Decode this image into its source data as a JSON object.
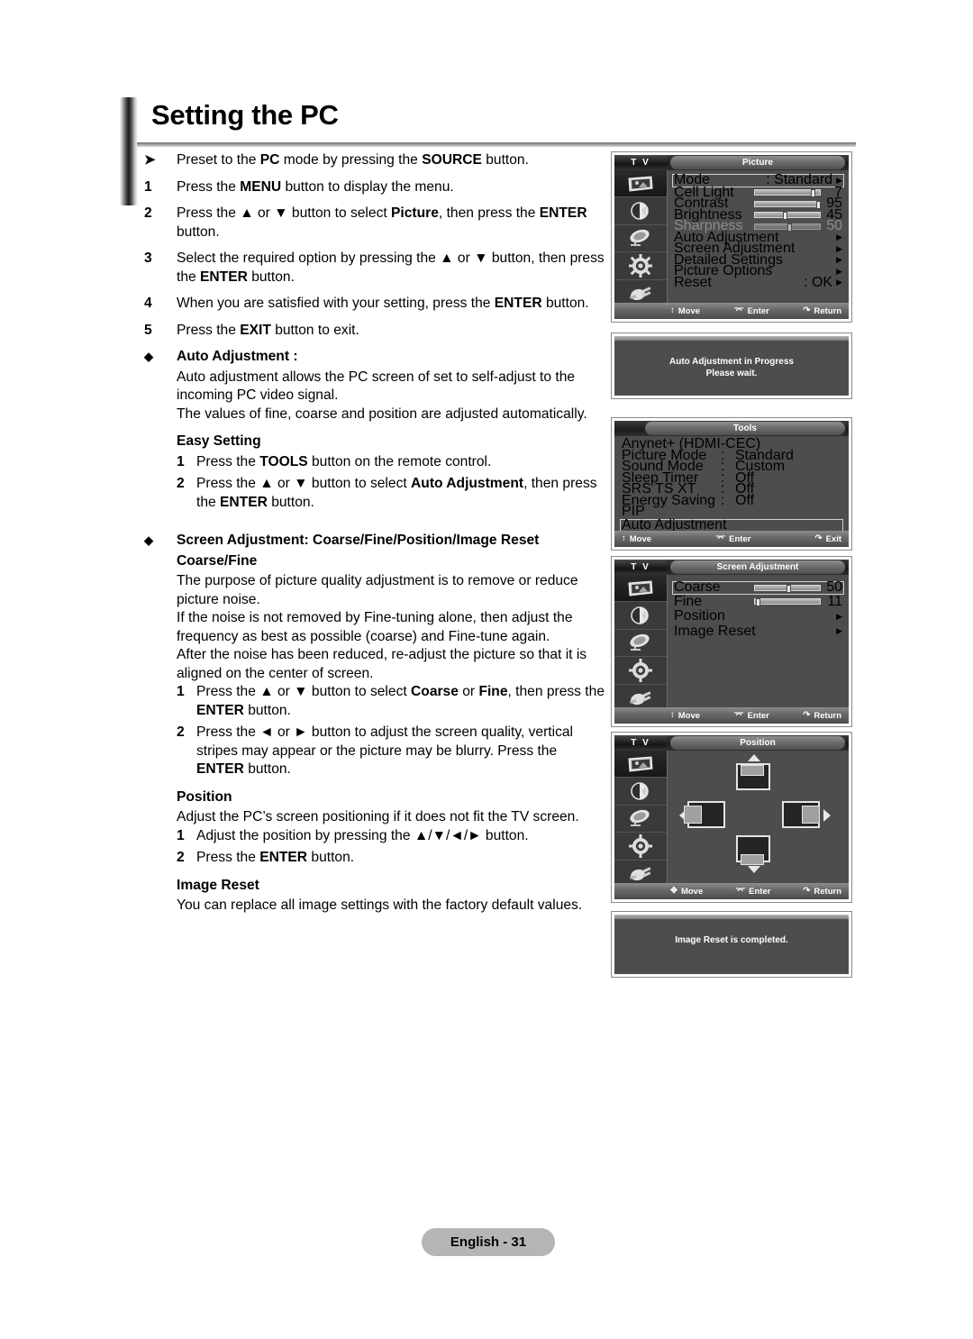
{
  "page": {
    "title": "Setting the PC",
    "footer_label": "English - 31"
  },
  "instructions": {
    "preset": {
      "marker": "➤",
      "text_1": "Preset to the ",
      "bold_1": "PC",
      "text_2": " mode by pressing the ",
      "bold_2": "SOURCE",
      "text_3": " button."
    },
    "steps": [
      {
        "num": "1",
        "html": "Press the <b>MENU</b> button to display the menu."
      },
      {
        "num": "2",
        "html": "Press the ▲ or ▼ button to select <b>Picture</b>, then press the <b>ENTER</b> button."
      },
      {
        "num": "3",
        "html": "Select the required option by pressing the ▲ or ▼ button, then press the <b>ENTER</b> button."
      },
      {
        "num": "4",
        "html": "When you are satisfied with your setting, press the <b>ENTER</b> button."
      },
      {
        "num": "5",
        "html": "Press the <b>EXIT</b> button to exit."
      }
    ]
  },
  "auto_adjustment_section": {
    "marker": "◆",
    "heading": "Auto Adjustment :",
    "paragraph_1": "Auto adjustment allows the PC screen of set to self-adjust to the incoming PC video signal.",
    "paragraph_2": "The values of fine, coarse and position are adjusted automatically.",
    "easy_setting_heading": "Easy Setting",
    "easy_setting_steps": [
      {
        "num": "1",
        "html": "Press the <b>TOOLS</b> button on the remote control."
      },
      {
        "num": "2",
        "html": "Press the ▲ or ▼ button to select <b>Auto Adjustment</b>, then press the <b>ENTER</b> button."
      }
    ]
  },
  "screen_adjustment_section": {
    "marker": "◆",
    "heading": "Screen Adjustment: Coarse/Fine/Position/Image Reset",
    "coarse_fine_heading": "Coarse/Fine",
    "paragraph_1": "The purpose of picture quality adjustment is to remove or reduce picture noise.",
    "paragraph_2": "If the noise is not removed by Fine-tuning alone, then adjust the frequency as best as possible (coarse) and Fine-tune again.",
    "paragraph_3": "After the noise has been reduced, re-adjust the picture so that it is aligned on the center of screen.",
    "steps": [
      {
        "num": "1",
        "html": "Press the ▲ or ▼ button to select <b>Coarse</b> or <b>Fine</b>, then press the <b>ENTER</b> button."
      },
      {
        "num": "2",
        "html": "Press the ◄ or ► button to adjust the screen quality, vertical stripes may appear or the picture may be blurry. Press the <b>ENTER</b> button."
      }
    ],
    "position_heading": "Position",
    "position_paragraph": "Adjust the PC’s screen positioning if it does not fit the TV screen.",
    "position_steps": [
      {
        "num": "1",
        "html": "Adjust the position by pressing the ▲/▼/◄/► button."
      },
      {
        "num": "2",
        "html": "Press the <b>ENTER</b> button."
      }
    ],
    "image_reset_heading": "Image Reset",
    "image_reset_paragraph": "You can replace all image settings with the factory default values."
  },
  "osd": {
    "tv_tag": "T V",
    "footer": {
      "move": "Move",
      "enter": "Enter",
      "return": "Return",
      "exit": "Exit"
    },
    "picture_menu": {
      "title": "Picture",
      "items": [
        {
          "label": "Mode",
          "value": ": Standard",
          "type": "value-arrow",
          "selected": true
        },
        {
          "label": "Cell Light",
          "type": "slider",
          "value": "7",
          "percent": 86
        },
        {
          "label": "Contrast",
          "type": "slider",
          "value": "95",
          "percent": 97
        },
        {
          "label": "Brightness",
          "type": "slider",
          "value": "45",
          "percent": 45
        },
        {
          "label": "Sharpness",
          "type": "slider",
          "value": "50",
          "percent": 52,
          "dimmed": true
        },
        {
          "label": "Auto Adjustment",
          "type": "arrow"
        },
        {
          "label": "Screen Adjustment",
          "type": "arrow"
        },
        {
          "label": "Detailed Settings",
          "type": "arrow"
        },
        {
          "label": "Picture Options",
          "type": "arrow"
        },
        {
          "label": "Reset",
          "value": ": OK",
          "type": "value-arrow"
        }
      ]
    },
    "auto_adjust_message": {
      "line_1": "Auto Adjustment in Progress",
      "line_2": "Please wait."
    },
    "tools_menu": {
      "title": "Tools",
      "items": [
        {
          "label": "Anynet+ (HDMI-CEC)",
          "sep": "",
          "value": ""
        },
        {
          "label": "Picture Mode",
          "sep": ":",
          "value": "Standard"
        },
        {
          "label": "Sound Mode",
          "sep": ":",
          "value": "Custom"
        },
        {
          "label": "Sleep Timer",
          "sep": ":",
          "value": "Off"
        },
        {
          "label": "SRS TS XT",
          "sep": ":",
          "value": "Off"
        },
        {
          "label": "Energy Saving",
          "sep": ":",
          "value": "Off"
        },
        {
          "label": "PIP",
          "sep": "",
          "value": ""
        },
        {
          "label": "Auto Adjustment",
          "sep": "",
          "value": "",
          "selected": true
        }
      ]
    },
    "screen_adjustment_menu": {
      "title": "Screen Adjustment",
      "items": [
        {
          "label": "Coarse",
          "type": "slider",
          "value": "50",
          "percent": 50,
          "selected": true
        },
        {
          "label": "Fine",
          "type": "slider",
          "value": "11",
          "percent": 5
        },
        {
          "label": "Position",
          "type": "arrow"
        },
        {
          "label": "Image Reset",
          "type": "arrow"
        }
      ]
    },
    "position_menu": {
      "title": "Position",
      "icons": [
        "up-position-icon",
        "left-position-icon",
        "right-position-icon",
        "down-position-icon"
      ]
    },
    "image_reset_message": {
      "line_1": "Image Reset is completed."
    }
  },
  "colors": {
    "osd_bg": "#4d4d4d",
    "rail_bg": "#3a3a3a",
    "footer_pill": "#b5b5b5"
  }
}
